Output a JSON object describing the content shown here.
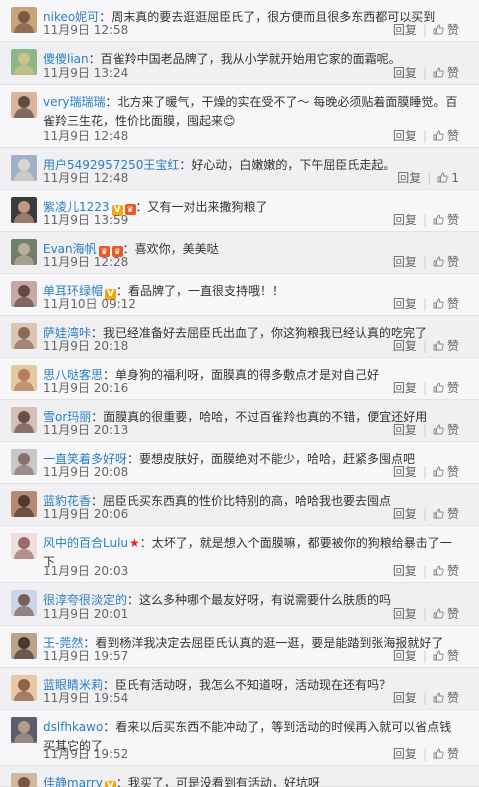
{
  "labels": {
    "reply": "回复",
    "like": "赞"
  },
  "comments": [
    {
      "user": "nikeo妮可",
      "text": "：周末真的要去逛逛屈臣氏了，很方便而且很多东西都可以买到",
      "time": "11月9日 12:58",
      "like_count": ""
    },
    {
      "user": "傻傻lian",
      "text": "：百雀羚中国老品牌了，我从小学就开始用它家的面霜呢。",
      "time": "11月9日 13:24",
      "like_count": ""
    },
    {
      "user": "very瑞瑞瑞",
      "text": "：北方来了暖气，干燥的实在受不了～ 每晚必须贴着面膜睡觉。百雀羚三生花，性价比面膜，囤起来😊",
      "time": "11月9日 12:48",
      "like_count": ""
    },
    {
      "user": "用户5492957250王宝红",
      "text": "：好心动，白嫩嫩的，下午屈臣氏走起。",
      "time": "11月9日 12:48",
      "like_count": "1"
    },
    {
      "user": "紫凌儿1223",
      "text": "：又有一对出来撒狗粮了",
      "time": "11月9日 13:59",
      "like_count": ""
    },
    {
      "user": "Evan海帆",
      "text": "：喜欢你，美美哒",
      "time": "11月9日 12:28",
      "like_count": ""
    },
    {
      "user": "单耳环绿帽",
      "text": "：看品牌了，一直很支持哦！！",
      "time": "11月10日 09:12",
      "like_count": ""
    },
    {
      "user": "萨娃湾咔",
      "text": "：我已经准备好去屈臣氏出血了，你这狗粮我已经认真的吃完了",
      "time": "11月9日 20:18",
      "like_count": ""
    },
    {
      "user": "思八哒客思",
      "text": "：单身狗的福利呀，面膜真的得多敷点才是对自己好",
      "time": "11月9日 20:16",
      "like_count": ""
    },
    {
      "user": "雪or玛丽",
      "text": "：面膜真的很重要，哈哈，不过百雀羚也真的不错，便宜还好用",
      "time": "11月9日 20:13",
      "like_count": ""
    },
    {
      "user": "一直笑着多好呀",
      "text": "：要想皮肤好，面膜绝对不能少，哈哈，赶紧多囤点吧",
      "time": "11月9日 20:08",
      "like_count": ""
    },
    {
      "user": "蓝豹花香",
      "text": "：屈臣氏买东西真的性价比特别的高，哈哈我也要去囤点",
      "time": "11月9日 20:06",
      "like_count": ""
    },
    {
      "user": "风中的百合Lulu",
      "text": "：太坏了，就是想入个面膜嘛，都要被你的狗粮给暴击了一下",
      "time": "11月9日 20:03",
      "like_count": ""
    },
    {
      "user": "很淳夸很淡定的",
      "text": "：这么多种哪个最友好呀，有说需要什么肤质的吗",
      "time": "11月9日 20:01",
      "like_count": ""
    },
    {
      "user": "王-莞然",
      "text": "：看到杨洋我决定去屈臣氏认真的逛一逛，要是能踏到张海报就好了",
      "time": "11月9日 19:57",
      "like_count": ""
    },
    {
      "user": "蓝眼睛米莉",
      "text": "：臣氏有活动呀，我怎么不知道呀，活动现在还有吗？",
      "time": "11月9日 19:54",
      "like_count": ""
    },
    {
      "user": "dslfhkawo",
      "text": "：看来以后买东西不能冲动了，等到活动的时候再入就可以省点钱买其它的了",
      "time": "11月9日 19:52",
      "like_count": ""
    },
    {
      "user": "佳静marry",
      "text": "：我买了，可是没看到有活动，好坑呀",
      "time": "",
      "like_count": ""
    }
  ]
}
